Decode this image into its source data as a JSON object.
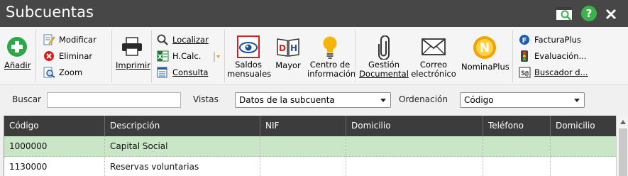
{
  "window": {
    "title": "Subcuentas"
  },
  "ribbon": {
    "add": "Añadir",
    "modify": "Modificar",
    "delete": "Eliminar",
    "zoom": "Zoom",
    "print": "Imprimir",
    "locate": "Localizar",
    "hcalc": "H.Calc.",
    "query": "Consulta",
    "balances_line1": "Saldos",
    "balances_line2": "mensuales",
    "ledger": "Mayor",
    "info_line1": "Centro de",
    "info_line2": "información",
    "docs_line1": "Gestión",
    "docs_line2": "Documental",
    "email_line1": "Correo",
    "email_line2": "electrónico",
    "nomina": "NominaPlus",
    "facturaplus": "FacturaPlus",
    "evaluacion": "Evaluación...",
    "buscador": "Buscador d..."
  },
  "filters": {
    "search_label": "Buscar",
    "search_value": "",
    "views_label": "Vistas",
    "views_value": "Datos de la subcuenta",
    "order_label": "Ordenación",
    "order_value": "Código"
  },
  "grid": {
    "columns": [
      "Código",
      "Descripción",
      "NIF",
      "Domicilio",
      "Teléfono",
      "Domicilio"
    ],
    "rows": [
      [
        "1000000",
        "Capital Social",
        "",
        "",
        "",
        ""
      ],
      [
        "1130000",
        "Reservas voluntarias",
        "",
        "",
        "",
        ""
      ]
    ],
    "selected_row": 0
  },
  "colors": {
    "titlebar": "#474747",
    "grid_header": "#3c3c3c",
    "selected_row": "#c9e6c6",
    "add_green": "#2aa84a",
    "help_green": "#3bb34a"
  }
}
